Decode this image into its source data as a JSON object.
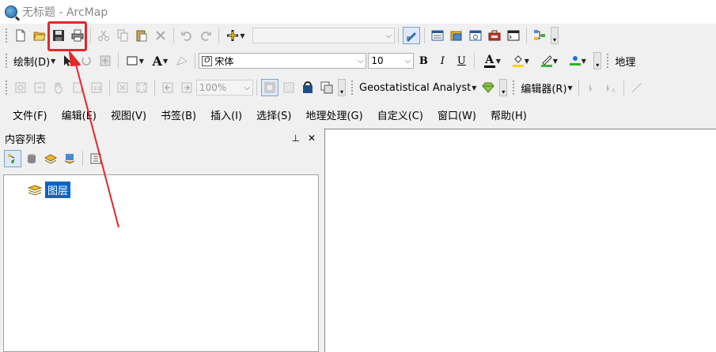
{
  "window": {
    "title": "无标题 - ArcMap"
  },
  "standard_toolbar": {
    "scale_value": "",
    "buttons": [
      "new",
      "open",
      "save",
      "print",
      "cut",
      "copy",
      "paste",
      "delete",
      "undo",
      "redo",
      "add-data"
    ]
  },
  "draw_toolbar": {
    "draw_label": "绘制(D)",
    "font_name": "宋体",
    "font_size": "10",
    "bold": "B",
    "italic": "I",
    "underline": "U",
    "font_color_letter": "A",
    "geoprocessing_cut": "地理"
  },
  "third_toolbar": {
    "zoom_value": "100%",
    "geostat_label": "Geostatistical Analyst",
    "editor_label": "编辑器(R)"
  },
  "menubar": {
    "items": [
      {
        "label": "文件(F)"
      },
      {
        "label": "编辑(E)"
      },
      {
        "label": "视图(V)"
      },
      {
        "label": "书签(B)"
      },
      {
        "label": "插入(I)"
      },
      {
        "label": "选择(S)"
      },
      {
        "label": "地理处理(G)"
      },
      {
        "label": "自定义(C)"
      },
      {
        "label": "窗口(W)"
      },
      {
        "label": "帮助(H)"
      }
    ]
  },
  "toc": {
    "title": "内容列表",
    "pin": "⊥",
    "close": "✕",
    "layer_root": "图层"
  },
  "colors": {
    "highlight": "#e5262a",
    "selection": "#0a64c8",
    "font_color_bar": "#000000",
    "fill_color_bar": "#f5d800",
    "line_color_bar": "#3cb43c",
    "marker_color_bar": "#2ab520"
  }
}
